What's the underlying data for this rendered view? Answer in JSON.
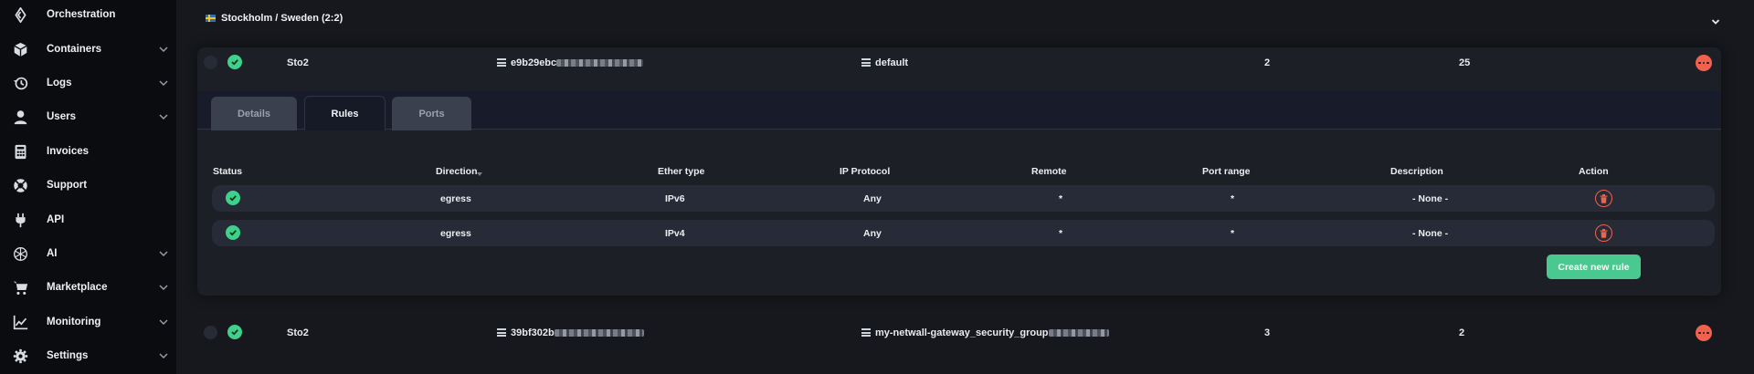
{
  "sidebar": {
    "items": [
      {
        "label": "Orchestration",
        "icon": "orchestration-icon",
        "chevron": false
      },
      {
        "label": "Containers",
        "icon": "cube-icon",
        "chevron": true
      },
      {
        "label": "Logs",
        "icon": "history-icon",
        "chevron": true
      },
      {
        "label": "Users",
        "icon": "user-icon",
        "chevron": true
      },
      {
        "label": "Invoices",
        "icon": "calculator-icon",
        "chevron": false
      },
      {
        "label": "Support",
        "icon": "lifebuoy-icon",
        "chevron": false
      },
      {
        "label": "API",
        "icon": "plug-icon",
        "chevron": false
      },
      {
        "label": "AI",
        "icon": "ai-icon",
        "chevron": true
      },
      {
        "label": "Marketplace",
        "icon": "cart-icon",
        "chevron": true
      },
      {
        "label": "Monitoring",
        "icon": "chart-icon",
        "chevron": true
      },
      {
        "label": "Settings",
        "icon": "gear-icon",
        "chevron": true
      }
    ]
  },
  "region": {
    "title": "Stockholm / Sweden (2:2)",
    "flag": "sweden-flag-icon"
  },
  "groups": [
    {
      "name": "Sto2",
      "id_prefix": "e9b29ebc",
      "security_group": "default",
      "rules_count": "2",
      "usage_count": "25"
    },
    {
      "name": "Sto2",
      "id_prefix": "39bf302b",
      "security_group": "my-netwall-gateway_security_group",
      "rules_count": "3",
      "usage_count": "2"
    }
  ],
  "tabs": [
    "Details",
    "Rules",
    "Ports"
  ],
  "rules_table": {
    "headers": [
      "Status",
      "Direction",
      "Ether type",
      "IP Protocol",
      "Remote",
      "Port range",
      "Description",
      "Action"
    ],
    "rows": [
      {
        "direction": "egress",
        "ether_type": "IPv6",
        "protocol": "Any",
        "remote": "*",
        "port_range": "*",
        "description": "- None -"
      },
      {
        "direction": "egress",
        "ether_type": "IPv4",
        "protocol": "Any",
        "remote": "*",
        "port_range": "*",
        "description": "- None -"
      }
    ]
  },
  "create_button": "Create new rule",
  "colors": {
    "accent_green": "#49c98f",
    "status_green": "#3fd18b",
    "danger": "#f0624d",
    "sidebar_bg": "#0b0c0f",
    "main_bg": "#16181d"
  }
}
